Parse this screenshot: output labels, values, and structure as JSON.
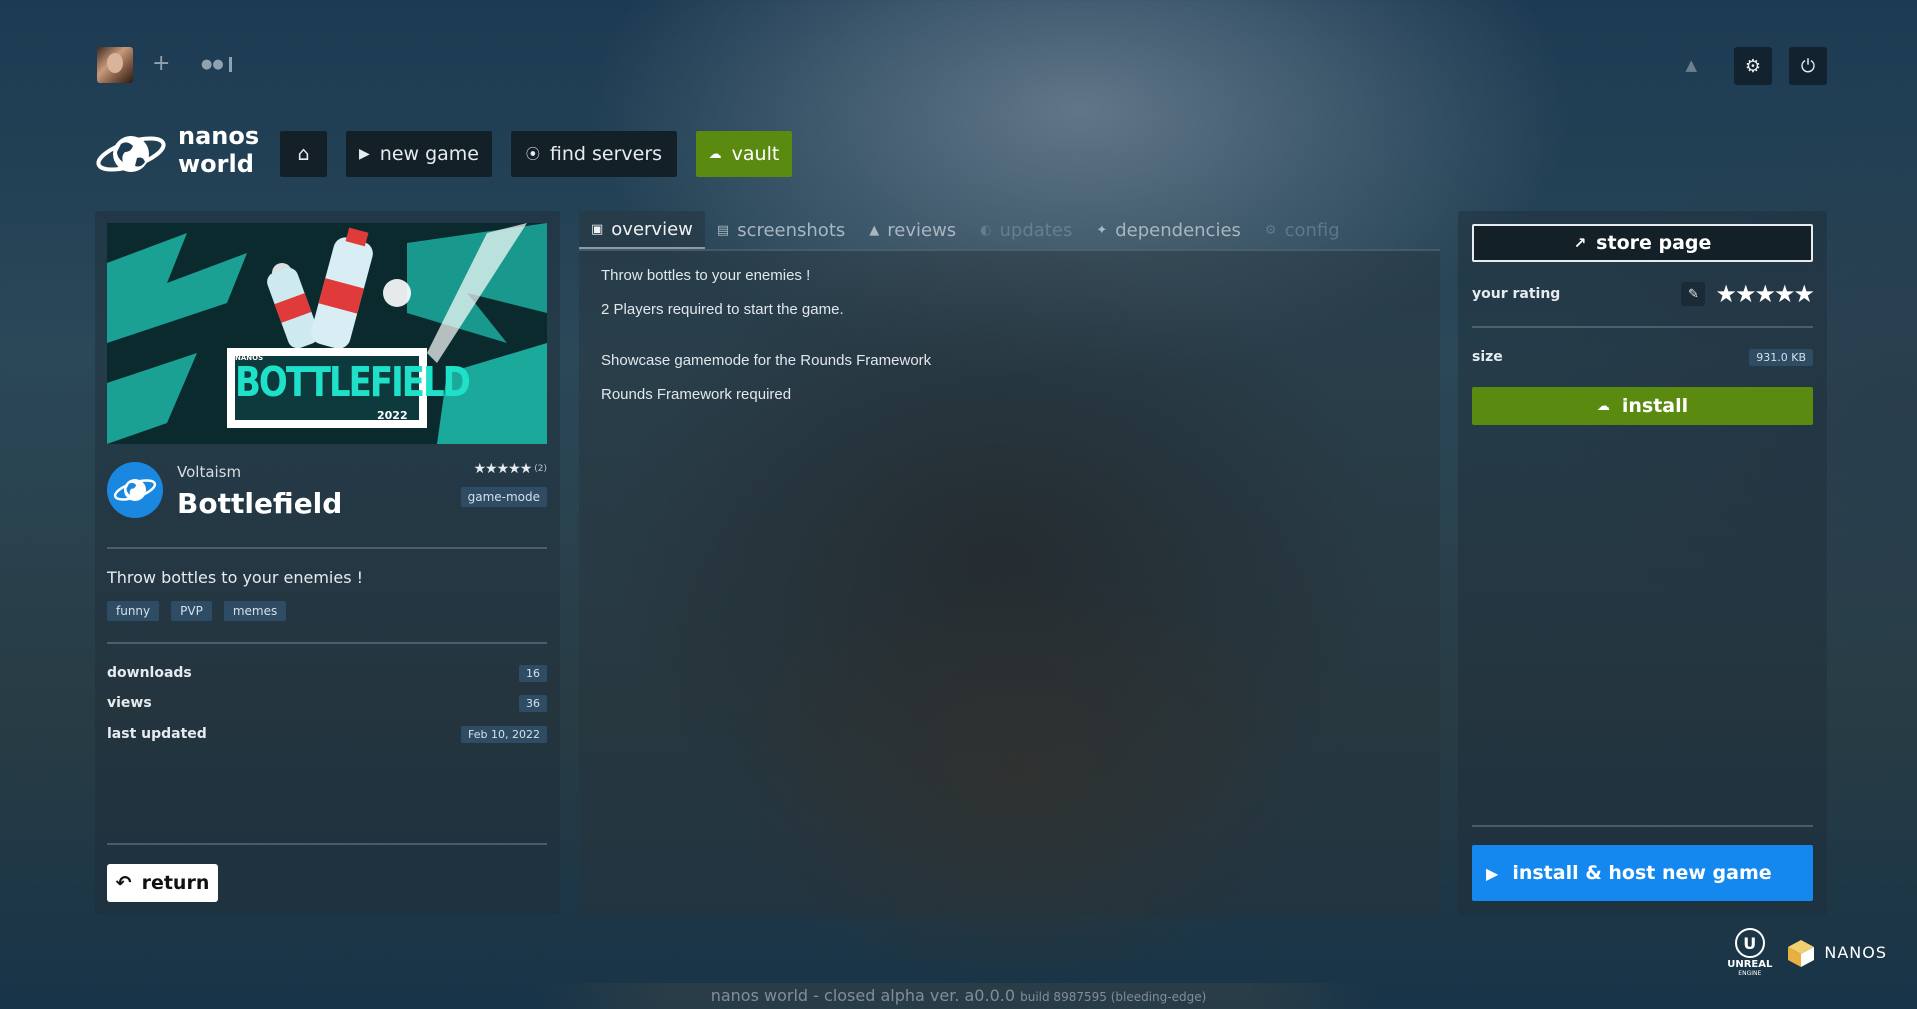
{
  "topbar": {
    "plus_label": "+",
    "friends_icon": "users-icon"
  },
  "brand": {
    "logo_line1": "nanos",
    "logo_line2": "world"
  },
  "nav": {
    "new_game": "new game",
    "find_servers": "find servers",
    "vault": "vault"
  },
  "game": {
    "author": "Voltaism",
    "title": "Bottlefield",
    "rating_count": "(2)",
    "type": "game-mode",
    "description": "Throw bottles to your enemies !",
    "tags": [
      "funny",
      "PVP",
      "memes"
    ],
    "image_text": "BOTTLEFIELD",
    "image_small": "NANOS",
    "image_year": "2022"
  },
  "stats": [
    {
      "label": "downloads",
      "value": "16"
    },
    {
      "label": "views",
      "value": "36"
    },
    {
      "label": "last updated",
      "value": "Feb 10, 2022"
    }
  ],
  "return_label": "return",
  "tabs": [
    {
      "label": "overview",
      "state": "active"
    },
    {
      "label": "screenshots",
      "state": "normal"
    },
    {
      "label": "reviews",
      "state": "normal"
    },
    {
      "label": "updates",
      "state": "disabled"
    },
    {
      "label": "dependencies",
      "state": "normal"
    },
    {
      "label": "config",
      "state": "disabled"
    }
  ],
  "overview": {
    "line1": "Throw bottles to your enemies !",
    "line2": "2 Players required to start the game.",
    "line3": "Showcase gamemode for the Rounds Framework",
    "line4": "Rounds Framework required"
  },
  "sidebar": {
    "store_page": "store page",
    "your_rating": "your rating",
    "size_label": "size",
    "size_value": "931.0 KB",
    "install": "install",
    "install_host": "install & host new game"
  },
  "engine": {
    "unreal": "UNREAL",
    "unreal_sub": "ENGINE",
    "nanos": "NANOS"
  },
  "footer": {
    "main": "nanos world - closed alpha ver. a0.0.0",
    "build": "build 8987595 (bleeding-edge)"
  },
  "colors": {
    "vault_green": "#5a8a10",
    "host_blue": "#1588f0",
    "badge_bg": "#2e4c64"
  }
}
